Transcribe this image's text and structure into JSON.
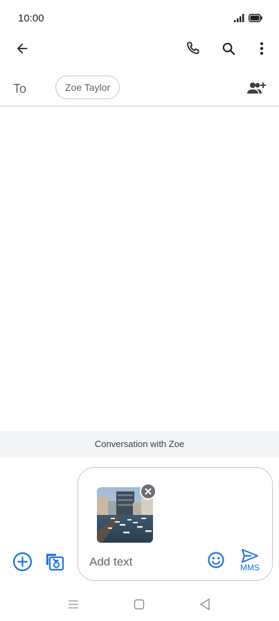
{
  "status_bar": {
    "time": "10:00"
  },
  "toolbar": {
    "back_icon": "arrow-left",
    "call_icon": "phone",
    "search_icon": "magnifier",
    "more_icon": "vertical-dots"
  },
  "recipients": {
    "to_label": "To",
    "chip_name": "Zoe Taylor",
    "add_people_icon": "person-add"
  },
  "conversation": {
    "banner_text": "Conversation with Zoe"
  },
  "compose": {
    "placeholder": "Add text",
    "attachment": "photo",
    "send_label": "MMS",
    "emoji_icon": "smiley"
  },
  "colors": {
    "accent": "#1a73e8",
    "banner_bg": "#f3f4f6",
    "text_primary": "#202124",
    "text_secondary": "#5f6368"
  }
}
